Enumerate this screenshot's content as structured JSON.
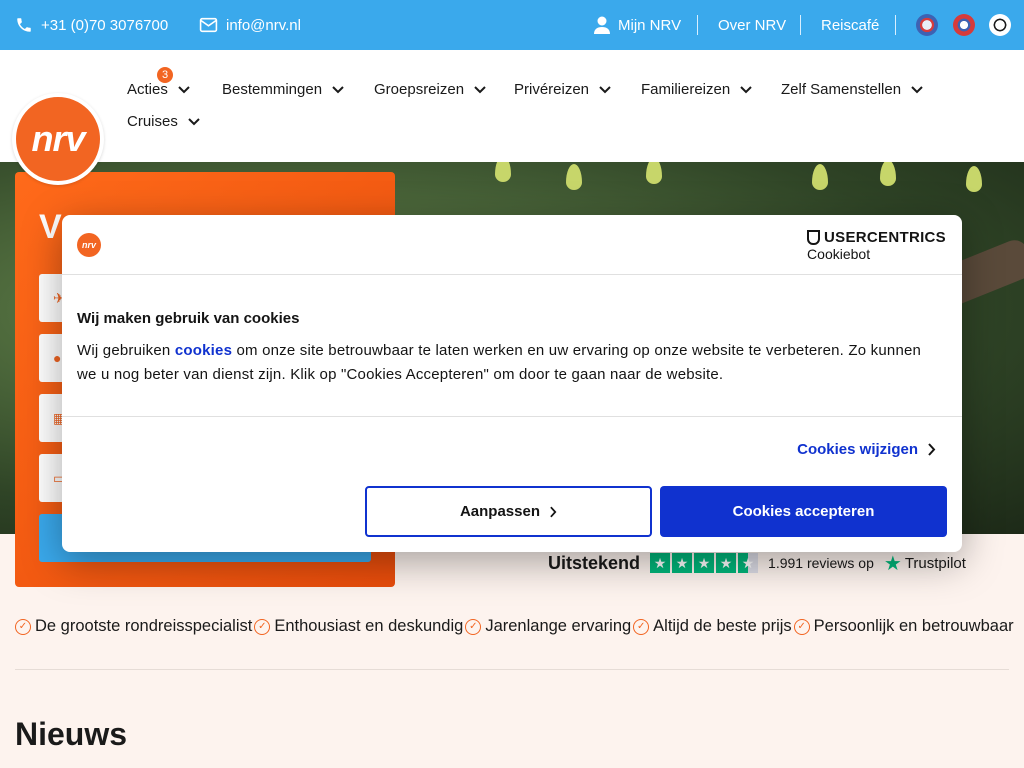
{
  "topbar": {
    "phone": "+31 (0)70 3076700",
    "email": "info@nrv.nl",
    "links": [
      "Mijn NRV",
      "Over NRV",
      "Reiscafé"
    ]
  },
  "nav": {
    "items": [
      "Acties",
      "Bestemmingen",
      "Groepsreizen",
      "Privéreizen",
      "Familiereizen",
      "Zelf Samenstellen",
      "Cruises"
    ],
    "acties_badge": "3"
  },
  "logo": {
    "text": "nrv"
  },
  "search": {
    "title": "V"
  },
  "trustpilot": {
    "label": "Uitstekend",
    "reviews": "1.991 reviews op",
    "brand": "Trustpilot",
    "rating_stars": 4.5
  },
  "usps": [
    "De grootste rondreisspecialist",
    "Enthousiast en deskundig",
    "Jarenlange ervaring",
    "Altijd de beste prijs",
    "Persoonlijk en betrouwbaar"
  ],
  "news": {
    "title": "Nieuws"
  },
  "cookie": {
    "brand_line1": "USERCENTRICS",
    "brand_line2": "Cookiebot",
    "title": "Wij maken gebruik van cookies",
    "body_pre": "Wij gebruiken ",
    "body_link": "cookies",
    "body_post": " om onze site betrouwbaar te laten werken en uw ervaring op onze website te verbeteren. Zo kunnen we u nog beter van dienst zijn. Klik op \"Cookies Accepteren\" om door te gaan naar de website.",
    "change_label": "Cookies wijzigen",
    "customize_label": "Aanpassen",
    "accept_label": "Cookies accepteren"
  },
  "colors": {
    "brand_orange": "#f26522",
    "topbar_blue": "#3aa9ec",
    "cookie_blue": "#1032cf",
    "trust_green": "#00b67a"
  }
}
